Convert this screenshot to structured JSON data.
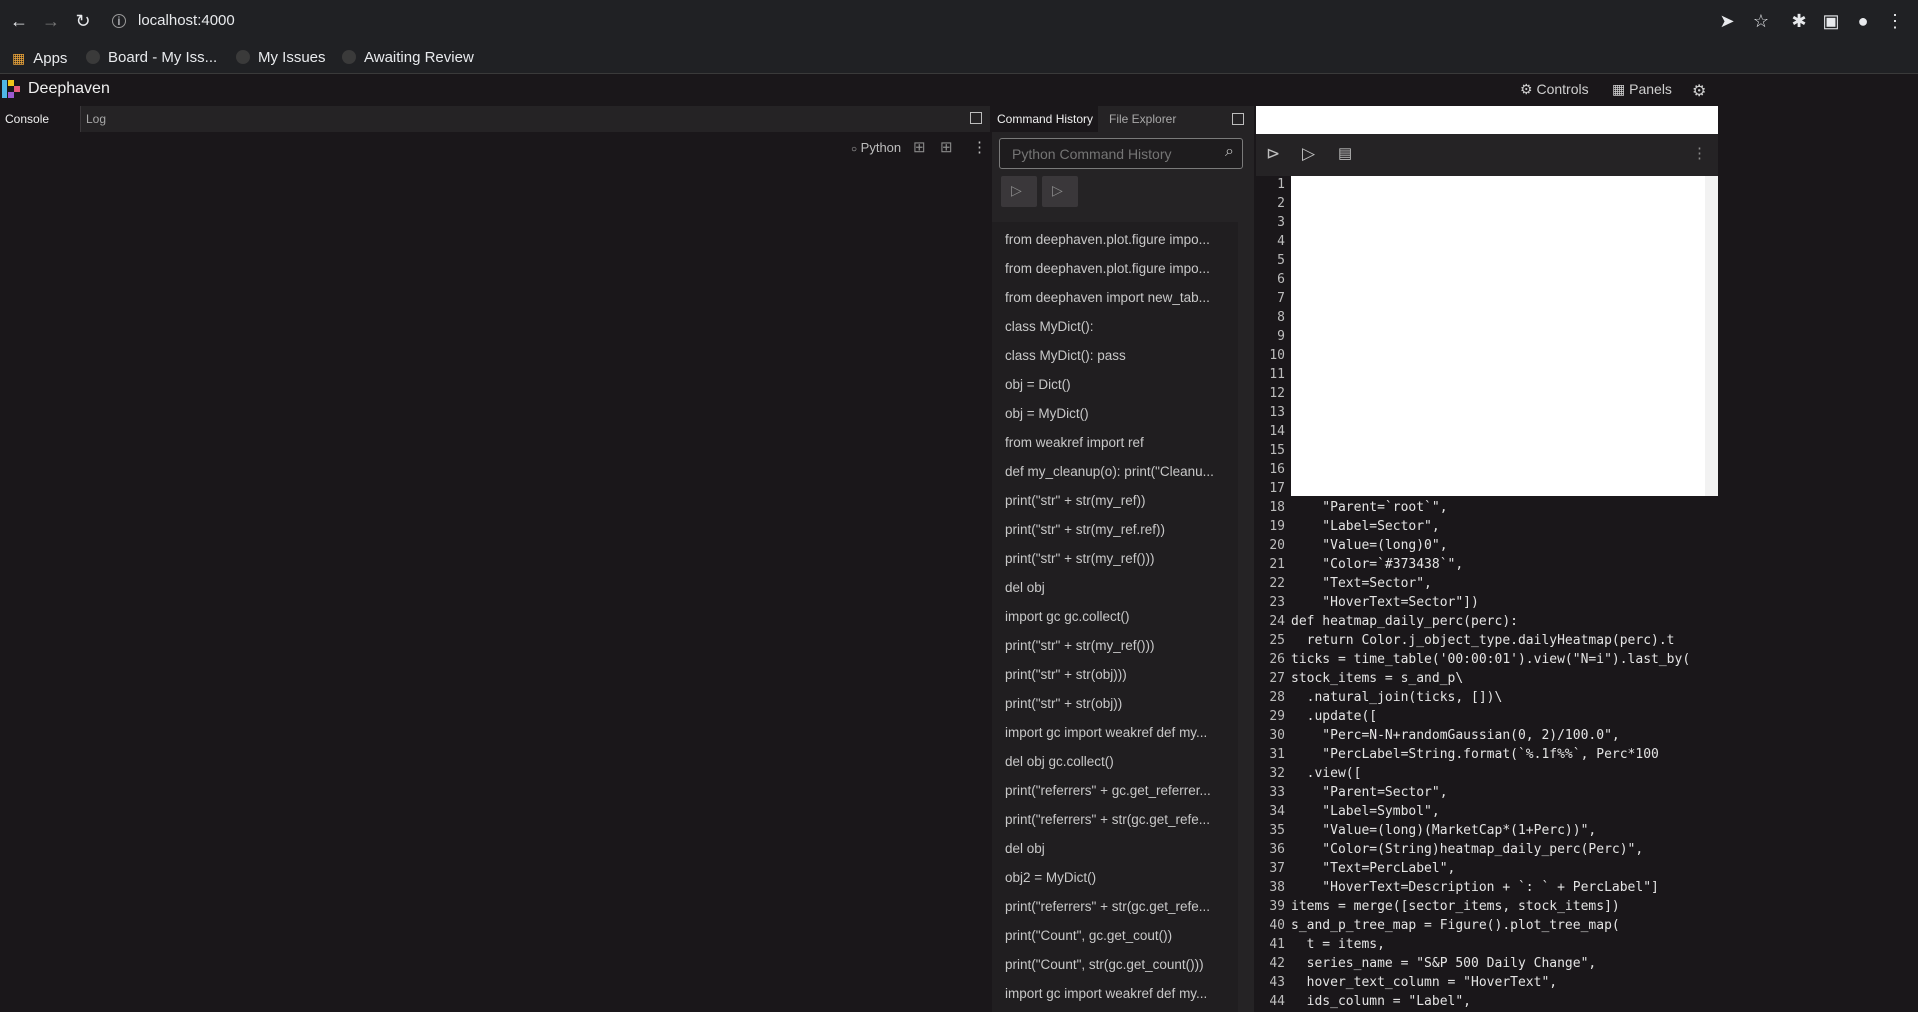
{
  "browser": {
    "url": "localhost:4000",
    "bookmarks": [
      "Apps",
      "Board - My Iss...",
      "My Issues",
      "Awaiting Review"
    ]
  },
  "app": {
    "title": "Deephaven",
    "controls_label": "Controls",
    "panels_label": "Panels"
  },
  "console": {
    "tabs": [
      "Console",
      "Log"
    ],
    "language": "Python"
  },
  "history": {
    "tabs": [
      "Command History",
      "File Explorer"
    ],
    "search_placeholder": "Python Command History",
    "items": [
      "from deephaven.plot.figure impo...",
      "from deephaven.plot.figure impo...",
      "from deephaven import new_tab...",
      "class MyDict():",
      "class MyDict(): pass",
      "obj = Dict()",
      "obj = MyDict()",
      "from weakref import ref",
      "def my_cleanup(o): print(\"Cleanu...",
      "print(\"str\" + str(my_ref))",
      "print(\"str\" + str(my_ref.ref))",
      "print(\"str\" + str(my_ref()))",
      "del obj",
      "import gc gc.collect()",
      "print(\"str\" + str(my_ref()))",
      "print(\"str\" + str(obj)))",
      "print(\"str\" + str(obj))",
      "import gc import weakref def my...",
      "del obj gc.collect()",
      "print(\"referrers\" + gc.get_referrer...",
      "print(\"referrers\" + str(gc.get_refe...",
      "del obj",
      "obj2 = MyDict()",
      "print(\"referrers\" + str(gc.get_refe...",
      "print(\"Count\", gc.get_cout())",
      "print(\"Count\", str(gc.get_count()))",
      "import gc import weakref def my..."
    ]
  },
  "editor": {
    "line_numbers": [
      "1",
      "2",
      "3",
      "4",
      "5",
      "6",
      "7",
      "8",
      "9",
      "10",
      "11",
      "12",
      "13",
      "14",
      "15",
      "16",
      "17",
      "18",
      "19",
      "20",
      "21",
      "22",
      "23",
      "24",
      "25",
      "26",
      "27",
      "28",
      "29",
      "30",
      "31",
      "32",
      "33",
      "34",
      "35",
      "36",
      "37",
      "38",
      "39",
      "40",
      "41",
      "42",
      "43",
      "44"
    ],
    "code_lines": [
      "    \"Parent=`root`\",",
      "    \"Label=Sector\",",
      "    \"Value=(long)0\",",
      "    \"Color=`#373438`\",",
      "    \"Text=Sector\",",
      "    \"HoverText=Sector\"])",
      "def heatmap_daily_perc(perc):",
      "  return Color.j_object_type.dailyHeatmap(perc).t",
      "ticks = time_table('00:00:01').view(\"N=i\").last_by(",
      "stock_items = s_and_p\\",
      "  .natural_join(ticks, [])\\",
      "  .update([",
      "    \"Perc=N-N+randomGaussian(0, 2)/100.0\",",
      "    \"PercLabel=String.format(`%.1f%%`, Perc*100",
      "  .view([",
      "    \"Parent=Sector\",",
      "    \"Label=Symbol\",",
      "    \"Value=(long)(MarketCap*(1+Perc))\",",
      "    \"Color=(String)heatmap_daily_perc(Perc)\",",
      "    \"Text=PercLabel\",",
      "    \"HoverText=Description + `: ` + PercLabel\"]",
      "items = merge([sector_items, stock_items])",
      "s_and_p_tree_map = Figure().plot_tree_map(",
      "  t = items,",
      "  series_name = \"S&P 500 Daily Change\",",
      "  hover_text_column = \"HoverText\",",
      "  ids_column = \"Label\","
    ]
  },
  "colors": {
    "accent": "#f0f0f0",
    "background": "#1a171a"
  }
}
